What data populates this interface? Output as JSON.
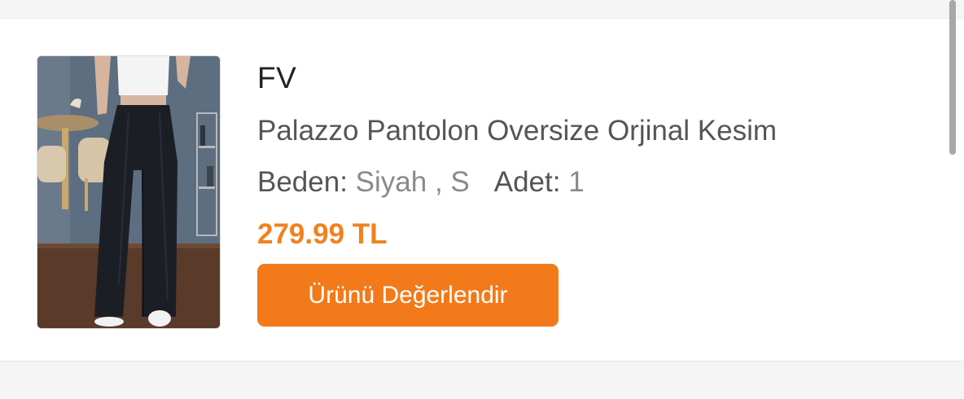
{
  "product": {
    "brand": "FV",
    "name": "Palazzo Pantolon Oversize Orjinal Kesim",
    "size_label": "Beden:",
    "size_value": "Siyah , S",
    "quantity_label": "Adet:",
    "quantity_value": "1",
    "price": "279.99 TL",
    "image_icon": "product-photo-black-palazzo-pants"
  },
  "actions": {
    "review_label": "Ürünü Değerlendir"
  },
  "colors": {
    "accent": "#f27a1a",
    "price": "#f0821e"
  }
}
